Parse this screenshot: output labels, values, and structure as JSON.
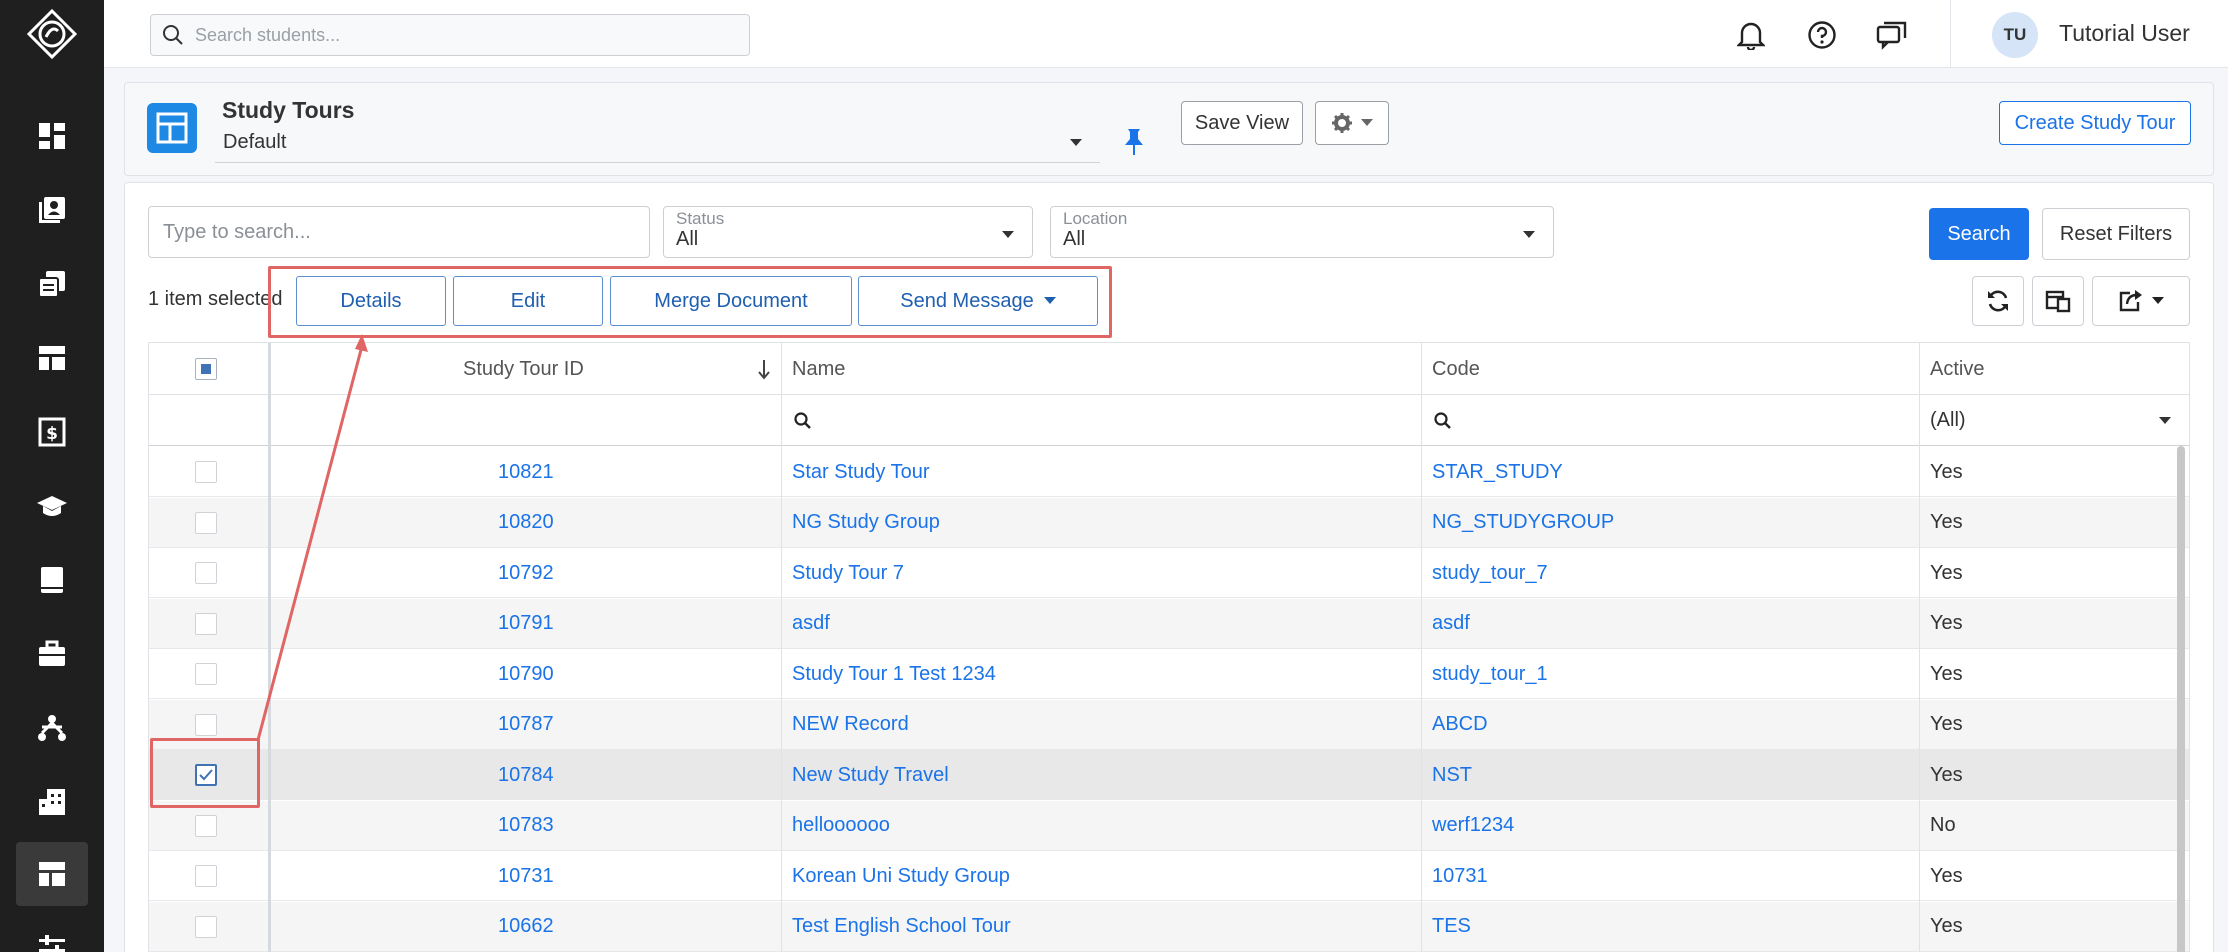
{
  "topbar": {
    "search_placeholder": "Search students...",
    "user_initials": "TU",
    "user_name": "Tutorial User"
  },
  "header": {
    "title": "Study Tours",
    "view": "Default",
    "save_view_label": "Save View",
    "create_label": "Create Study Tour"
  },
  "filters": {
    "search_placeholder": "Type to search...",
    "status_label": "Status",
    "status_value": "All",
    "location_label": "Location",
    "location_value": "All",
    "search_button": "Search",
    "reset_button": "Reset Filters"
  },
  "selection": {
    "text": "1 item selected",
    "details": "Details",
    "edit": "Edit",
    "merge": "Merge Document",
    "send_message": "Send Message"
  },
  "grid": {
    "columns": {
      "id": "Study Tour ID",
      "name": "Name",
      "code": "Code",
      "active": "Active"
    },
    "active_filter": "(All)",
    "rows": [
      {
        "id": "10821",
        "name": "Star Study Tour",
        "code": "STAR_STUDY",
        "active": "Yes"
      },
      {
        "id": "10820",
        "name": "NG Study Group",
        "code": "NG_STUDYGROUP",
        "active": "Yes"
      },
      {
        "id": "10792",
        "name": "Study Tour 7",
        "code": "study_tour_7",
        "active": "Yes"
      },
      {
        "id": "10791",
        "name": "asdf",
        "code": "asdf",
        "active": "Yes"
      },
      {
        "id": "10790",
        "name": "Study Tour 1 Test 1234",
        "code": "study_tour_1",
        "active": "Yes"
      },
      {
        "id": "10787",
        "name": "NEW Record",
        "code": "ABCD",
        "active": "Yes"
      },
      {
        "id": "10784",
        "name": "New Study Travel",
        "code": "NST",
        "active": "Yes"
      },
      {
        "id": "10783",
        "name": "helloooooo",
        "code": "werf1234",
        "active": "No"
      },
      {
        "id": "10731",
        "name": "Korean Uni Study Group",
        "code": "10731",
        "active": "Yes"
      },
      {
        "id": "10662",
        "name": "Test English School Tour",
        "code": "TES",
        "active": "Yes"
      }
    ]
  },
  "colors": {
    "accent": "#1a73e8",
    "sidebar": "#1f1f1f",
    "annotation": "#e06565"
  }
}
